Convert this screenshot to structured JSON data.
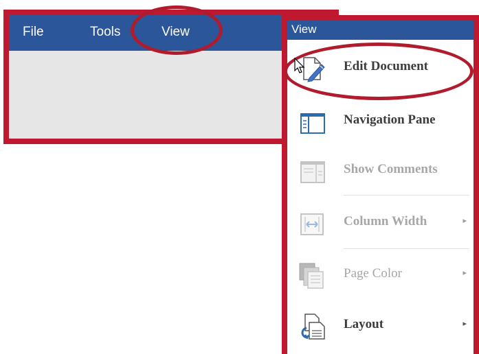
{
  "menubar": {
    "items": [
      {
        "label": "File"
      },
      {
        "label": "Tools"
      },
      {
        "label": "View"
      }
    ]
  },
  "dropdown": {
    "title": "View",
    "items": [
      {
        "label": "Edit Document",
        "icon": "edit-document-icon",
        "enabled": true,
        "submenu": false
      },
      {
        "label": "Navigation Pane",
        "icon": "navigation-pane-icon",
        "enabled": true,
        "submenu": false
      },
      {
        "label": "Show Comments",
        "icon": "show-comments-icon",
        "enabled": false,
        "submenu": false
      },
      {
        "label": "Column Width",
        "icon": "column-width-icon",
        "enabled": false,
        "submenu": true
      },
      {
        "label": "Page Color",
        "icon": "page-color-icon",
        "enabled": false,
        "submenu": true
      },
      {
        "label": "Layout",
        "icon": "layout-icon",
        "enabled": true,
        "submenu": true
      }
    ]
  },
  "colors": {
    "ribbon_blue": "#2b579a",
    "highlight_red": "#c0192f",
    "panel_gray": "#e6e6e6",
    "disabled_text": "#a7a7a7"
  }
}
